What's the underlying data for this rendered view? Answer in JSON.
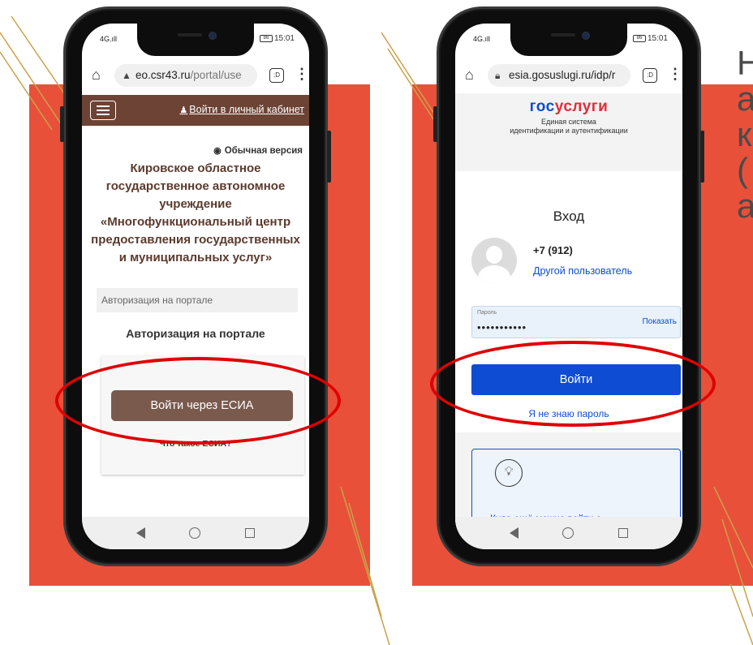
{
  "colors": {
    "accent_red": "#e8503a",
    "mfc_brown": "#6c4334",
    "esia_button": "#7a5a4d",
    "gosuslugi_blue": "#0d4cd3",
    "gosuslugi_red": "#e22b3b",
    "highlight_ellipse": "#e00000"
  },
  "left_phone": {
    "status": {
      "signal": "4G.ıll",
      "battery": "86",
      "time": "15:01"
    },
    "browser": {
      "url_domain": "eo.csr43.ru",
      "url_path": "/portal/use",
      "tabs_count": ":D"
    },
    "header": {
      "menu_icon": "hamburger-icon",
      "login_link": "Войти в личный кабинет"
    },
    "version_link": "Обычная версия",
    "title_lines": [
      "Кировское областное",
      "государственное автономное",
      "учреждение",
      "«Многофункциональный центр",
      "предоставления государственных",
      "и муниципальных услуг»"
    ],
    "breadcrumb": "Авторизация на портале",
    "auth_heading": "Авторизация на портале",
    "esia_button": "Войти через ЕСИА",
    "what_is_esia": "Что такое ЕСИА?"
  },
  "right_phone": {
    "status": {
      "signal": "4G.ıll",
      "battery": "86",
      "time": "15:01"
    },
    "browser": {
      "url": "esia.gosuslugi.ru/idp/r",
      "tabs_count": ":D"
    },
    "logo": {
      "part1": "гос",
      "part2": "услуги"
    },
    "logo_subtitle_lines": [
      "Единая система",
      "идентификации и аутентификации"
    ],
    "heading": "Вход",
    "user_phone": "+7 (912)",
    "other_user_link": "Другой пользователь",
    "password": {
      "label": "Пароль",
      "value": "•••••••••••",
      "show_link": "Показать"
    },
    "login_button": "Войти",
    "forgot_link": "Я не знаю пароль",
    "info_card_text": "Куда ещё можно войти с"
  },
  "side_text_lines": [
    "Н",
    "а",
    "к",
    "(",
    "а"
  ]
}
